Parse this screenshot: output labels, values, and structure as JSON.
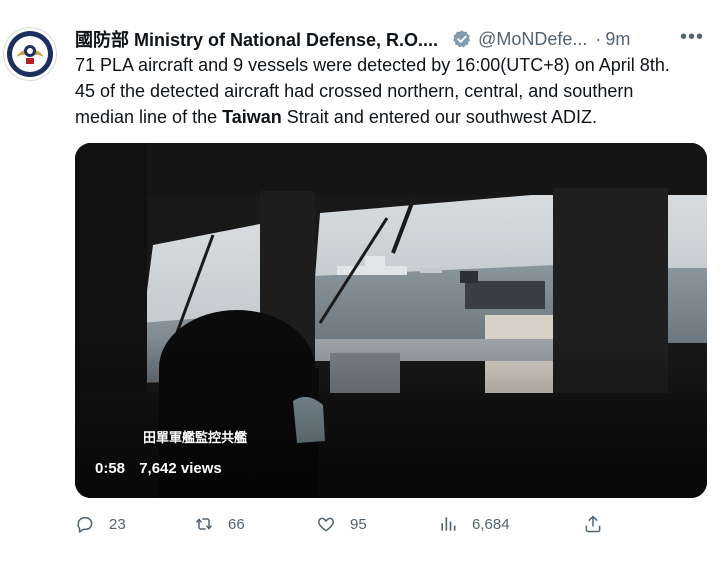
{
  "tweet": {
    "author_name": "國防部 Ministry of National Defense, R.O....",
    "handle": "@MoNDefe...",
    "separator": "·",
    "time": "9m",
    "more": "•••",
    "text_line1": "71 PLA aircraft and 9 vessels were detected by 16:00(UTC+8) on April 8th.",
    "text_line2": "45 of the detected aircraft had crossed northern, central, and southern",
    "text_line3_pre": "median line of the ",
    "text_bold": "Taiwan",
    "text_line3_post": " Strait and entered our southwest ADIZ."
  },
  "video": {
    "caption": "田單軍艦監控共艦",
    "duration": "0:58",
    "views": "7,642 views"
  },
  "actions": {
    "replies": "23",
    "retweets": "66",
    "likes": "95",
    "views": "6,684"
  },
  "icons": {
    "verified": "verified-badge-icon",
    "reply": "reply-icon",
    "retweet": "retweet-icon",
    "like": "heart-icon",
    "views": "views-chart-icon",
    "share": "share-icon"
  },
  "colors": {
    "text": "#0f1419",
    "muted": "#536471",
    "verified": "#829aab"
  }
}
